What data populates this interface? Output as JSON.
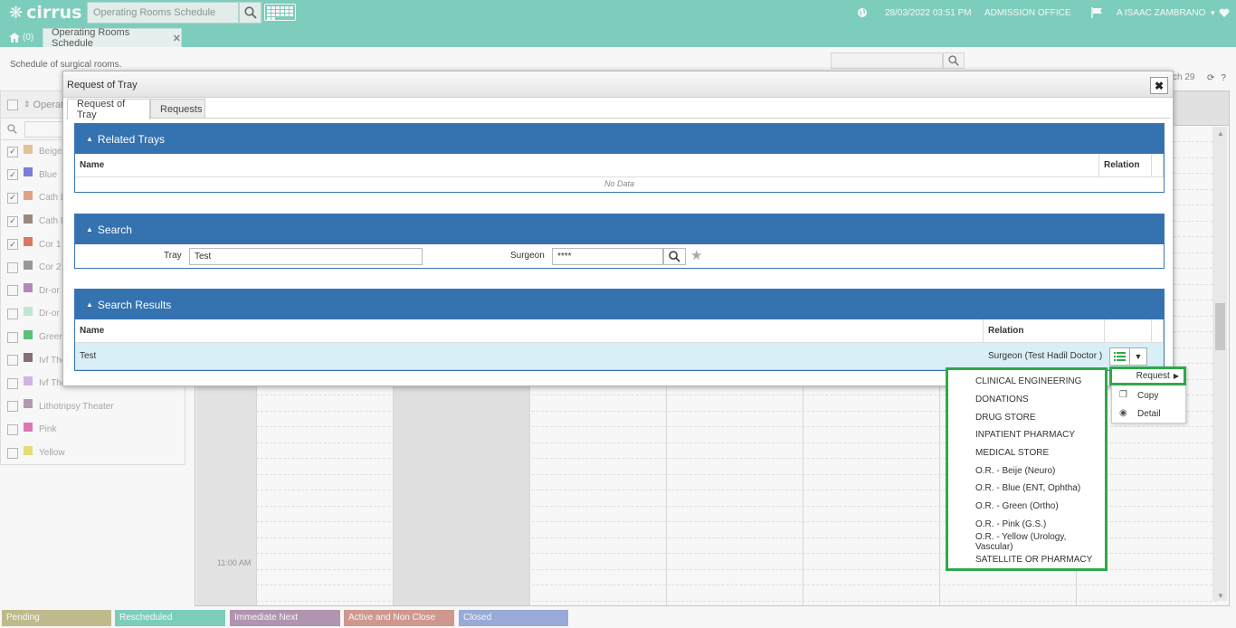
{
  "app": {
    "logo_text": "cirrus",
    "search_placeholder": "Operating Rooms Schedule",
    "datetime": "28/03/2022 03:51 PM",
    "office": "ADMISSION OFFICE",
    "user": "A ISAAC ZAMBRANO"
  },
  "tabs": {
    "home_count": "(0)",
    "active_tab": "Operating Rooms Schedule"
  },
  "page": {
    "description": "Schedule of surgical rooms.",
    "date_fragment": "ch 29"
  },
  "sidebar": {
    "header": "Operati",
    "rooms": [
      {
        "label": "Beige",
        "checked": true,
        "color": "#e8c99a"
      },
      {
        "label": "Blue",
        "checked": true,
        "color": "#7b7fe0"
      },
      {
        "label": "Cath L",
        "checked": true,
        "color": "#e8a58a"
      },
      {
        "label": "Cath L",
        "checked": true,
        "color": "#a08c80"
      },
      {
        "label": "Cor 1",
        "checked": true,
        "color": "#e07a5f"
      },
      {
        "label": "Cor 2",
        "checked": false,
        "color": "#9a9a9a"
      },
      {
        "label": "Dr-or",
        "checked": false,
        "color": "#b98ac0"
      },
      {
        "label": "Dr-or",
        "checked": false,
        "color": "#c8ecd8"
      },
      {
        "label": "Green",
        "checked": false,
        "color": "#5ec47a"
      },
      {
        "label": "Ivf The",
        "checked": false,
        "color": "#8a6f7a"
      },
      {
        "label": "Ivf The",
        "checked": false,
        "color": "#d7b8f0"
      },
      {
        "label": "Lithotripsy Theater",
        "checked": false,
        "color": "#b89bb0"
      },
      {
        "label": "Pink",
        "checked": false,
        "color": "#e27ab8"
      },
      {
        "label": "Yellow",
        "checked": false,
        "color": "#eee37a"
      }
    ]
  },
  "calendar": {
    "time_label": "11:00 AM"
  },
  "status_legend": [
    {
      "label": "Pending",
      "color": "#c4bf8e"
    },
    {
      "label": "Rescheduled",
      "color": "#7fd3c2"
    },
    {
      "label": "Immediate Next",
      "color": "#b597b5"
    },
    {
      "label": "Active and Non Close",
      "color": "#d49b92"
    },
    {
      "label": "Closed",
      "color": "#9aaedf"
    }
  ],
  "modal": {
    "title": "Request of Tray",
    "tabs": [
      "Request of Tray",
      "Requests"
    ],
    "related_trays": {
      "header": "Related Trays",
      "col_name": "Name",
      "col_relation": "Relation",
      "empty_text": "No Data"
    },
    "search": {
      "header": "Search",
      "tray_label": "Tray",
      "tray_value": "Test",
      "surgeon_label": "Surgeon",
      "surgeon_value": "****"
    },
    "results": {
      "header": "Search Results",
      "col_name": "Name",
      "col_relation": "Relation",
      "rows": [
        {
          "name": "Test",
          "relation": "Surgeon (Test Hadil Doctor )"
        }
      ]
    }
  },
  "context_menu": {
    "request": "Request",
    "copy": "Copy",
    "detail": "Detail"
  },
  "request_submenu": [
    "CLINICAL ENGINEERING",
    "DONATIONS",
    "DRUG STORE",
    "INPATIENT PHARMACY",
    "MEDICAL STORE",
    "O.R. - Beije (Neuro)",
    "O.R. - Blue (ENT, Ophtha)",
    "O.R. - Green (Ortho)",
    "O.R. - Pink (G.S.)",
    "O.R. - Yellow (Urology, Vascular)",
    "SATELLITE OR PHARMACY"
  ]
}
